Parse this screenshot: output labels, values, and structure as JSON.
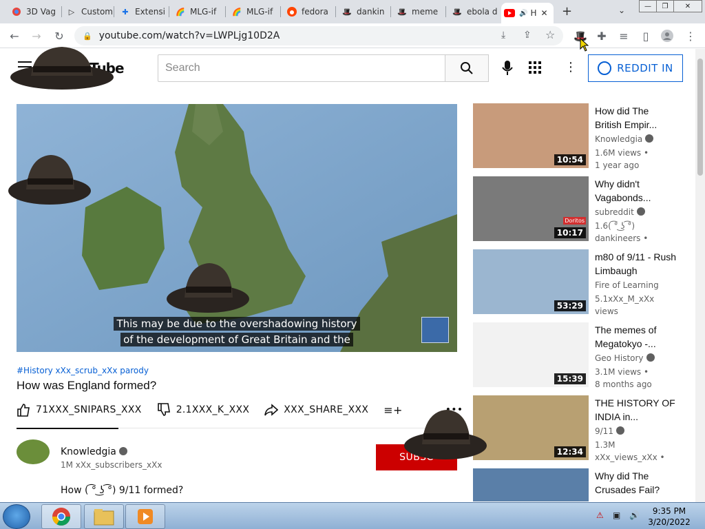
{
  "browser": {
    "tabs": [
      {
        "label": "3D Vag",
        "icon": "chrome-rainbow-icon"
      },
      {
        "label": "Custom",
        "icon": "cursor-arrow-icon"
      },
      {
        "label": "Extensi",
        "icon": "puzzle-icon"
      },
      {
        "label": "MLG-if",
        "icon": "rainbow-icon"
      },
      {
        "label": "MLG-if",
        "icon": "rainbow-icon"
      },
      {
        "label": "fedora",
        "icon": "reddit-icon"
      },
      {
        "label": "dankin",
        "icon": "hat-icon"
      },
      {
        "label": "meme",
        "icon": "hat-icon"
      },
      {
        "label": "ebola d",
        "icon": "hat-icon"
      },
      {
        "label": "H",
        "icon": "youtube-icon",
        "active": true
      }
    ],
    "url": "youtube.com/watch?v=LWPLjg10D2A"
  },
  "youtube": {
    "logo_text": "Tube",
    "search_placeholder": "Search",
    "signin_label": "REDDIT IN"
  },
  "video": {
    "caption_line1": "This may be due to the overshadowing history",
    "caption_line2": "of the development of Great Britain and the",
    "tags": "#History xXx_scrub_xXx parody",
    "title": "How was England formed?",
    "likes": "71XXX_SNIPARS_XXX",
    "dislikes": "2.1XXX_K_XXX",
    "share": "XXX_SHARE_XXX",
    "channel_name": "Knowledgia",
    "channel_subs": "1M xXx_subscribers_xXx",
    "subscribe_label": "SUBSC",
    "description": "How ( ͡° ͜ʖ ͡°) 9/11 formed?"
  },
  "related": [
    {
      "title": "How did The British Empir...",
      "channel": "Knowledgia",
      "meta1": "1.6M views •",
      "meta2": "1 year ago",
      "duration": "10:54",
      "thumb_color": "#c89b7b"
    },
    {
      "title": "Why didn't Vagabonds...",
      "channel": "subreddit",
      "meta1": "1.6( ͡° ͜ʖ ͡°)",
      "meta2": "dankineers •",
      "duration": "10:17",
      "thumb_color": "#7a7a7a",
      "badge": "Doritos"
    },
    {
      "title": "m80 of 9/11 - Rush Limbaugh",
      "channel": "Fire of Learning",
      "meta1": "5.1xXx_M_xXx",
      "meta2": "views",
      "duration": "53:29",
      "thumb_color": "#9bb6d0"
    },
    {
      "title": "The memes of Megatokyo -...",
      "channel": "Geo History",
      "meta1": "3.1M views •",
      "meta2": "8 months ago",
      "duration": "15:39",
      "thumb_color": "#f2f2f2"
    },
    {
      "title": "THE HISTORY OF INDIA in...",
      "channel": "9/11",
      "meta1": "1.3M",
      "meta2": "xXx_views_xXx •",
      "duration": "12:34",
      "thumb_color": "#b8a072"
    },
    {
      "title": "Why did The Crusades Fail?",
      "channel": "",
      "meta1": "",
      "meta2": "",
      "duration": "",
      "thumb_color": "#5a7fa8"
    }
  ],
  "taskbar": {
    "time": "9:35 PM",
    "date": "3/20/2022"
  }
}
